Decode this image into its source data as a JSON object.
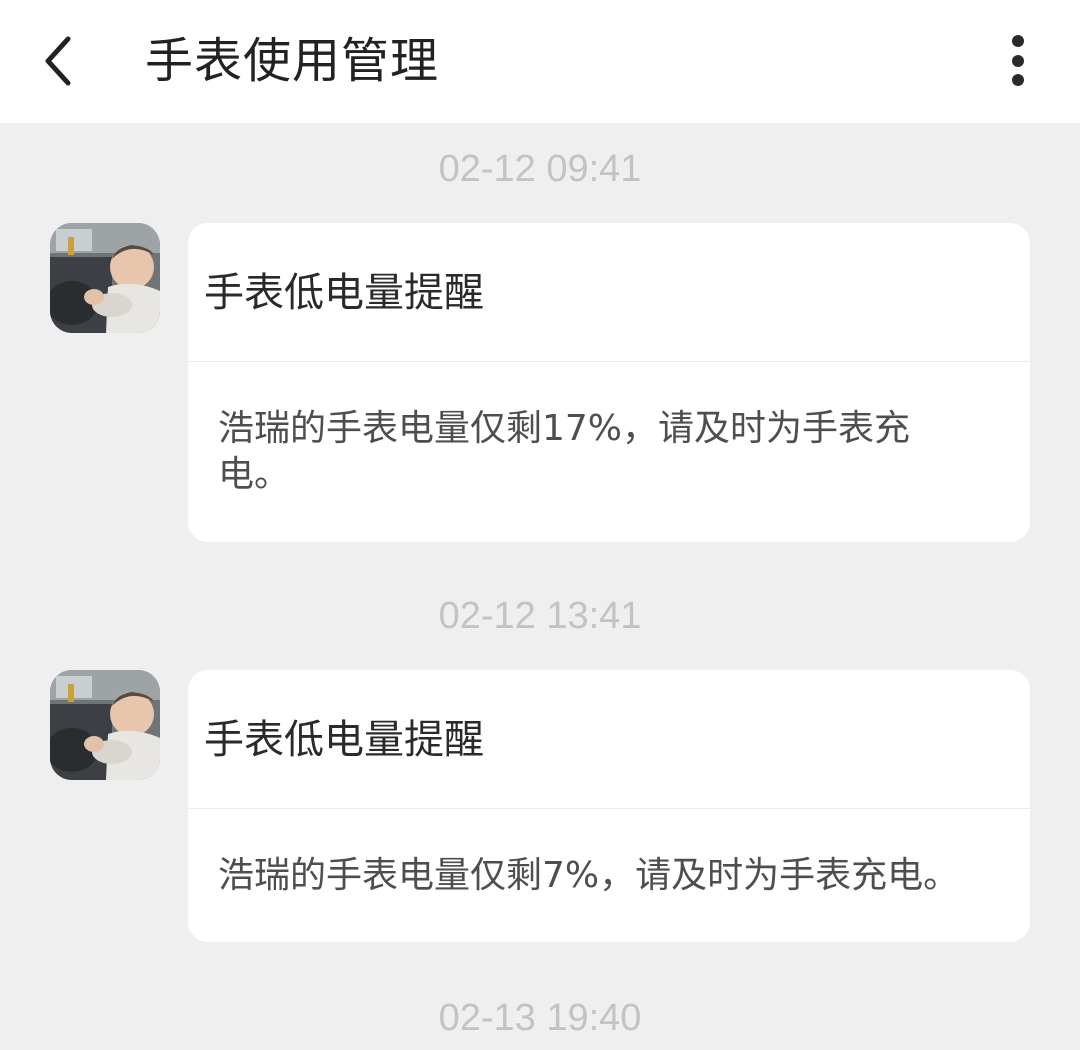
{
  "header": {
    "title": "手表使用管理",
    "back_icon": "chevron-left-icon",
    "more_icon": "more-vertical-icon"
  },
  "messages": [
    {
      "time": "02-12 09:41",
      "title": "手表低电量提醒",
      "body": "浩瑞的手表电量仅剩17%，请及时为手表充电。"
    },
    {
      "time": "02-12 13:41",
      "title": "手表低电量提醒",
      "body": "浩瑞的手表电量仅剩7%，请及时为手表充电。"
    },
    {
      "time": "02-13 19:40"
    }
  ],
  "colors": {
    "background": "#efefef",
    "card": "#ffffff",
    "timestamp": "#c3c3c3",
    "title_text": "#222222",
    "body_text": "#4e4e4e"
  }
}
